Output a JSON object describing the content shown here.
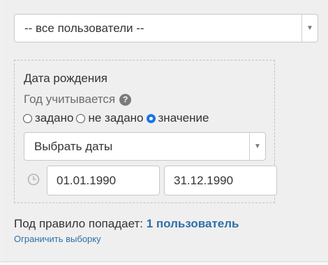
{
  "users_select": {
    "value": "-- все пользователи --"
  },
  "filter": {
    "title": "Дата рождения",
    "year_label": "Год учитывается",
    "help_icon": "question-circle-icon",
    "radios": [
      {
        "label": "задано",
        "checked": false
      },
      {
        "label": "не задано",
        "checked": false
      },
      {
        "label": "значение",
        "checked": true
      }
    ],
    "dates_select": {
      "value": "Выбрать даты"
    },
    "clock_icon": "clock-icon",
    "date_from": "01.01.1990",
    "date_to": "31.12.1990"
  },
  "rule": {
    "prefix": "Под правило попадает:",
    "count": "1 пользователь"
  },
  "limit_link": "Ограничить выборку",
  "colors": {
    "accent": "#2f6fa8",
    "radio_checked": "#1a73e8"
  }
}
